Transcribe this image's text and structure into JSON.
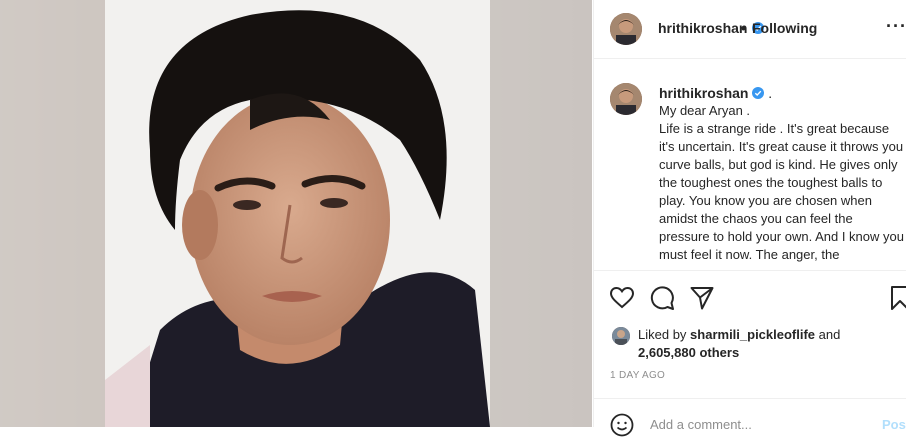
{
  "post": {
    "username": "hrithikroshan",
    "follow_sep": "•",
    "follow_label": "Following",
    "more_icon": "more-dots-icon",
    "caption_user": "hrithikroshan",
    "caption_suffix": ".",
    "caption_text": "My dear Aryan .\nLife is a strange ride . It's great because it's uncertain. It's great cause it throws you curve balls, but god is kind. He gives only the toughest ones the toughest balls to play. You know you are chosen when amidst the chaos you can feel the pressure to hold your own. And I know you must feel it now. The anger, the",
    "liked_by_prefix": "Liked by",
    "liked_by_user": "sharmili_pickleoflife",
    "liked_by_and": "and",
    "likes_count": "2,605,880 others",
    "timestamp": "1 DAY AGO",
    "comment_placeholder": "Add a comment...",
    "post_button": "Post"
  },
  "icons": [
    "heart-icon",
    "comment-icon",
    "share-icon",
    "bookmark-icon",
    "emoji-icon",
    "verified-icon"
  ],
  "colors": {
    "verified": "#3897f0",
    "border": "#efefef",
    "muted": "#8e8e8e",
    "post_disabled": "#b2dffc"
  }
}
